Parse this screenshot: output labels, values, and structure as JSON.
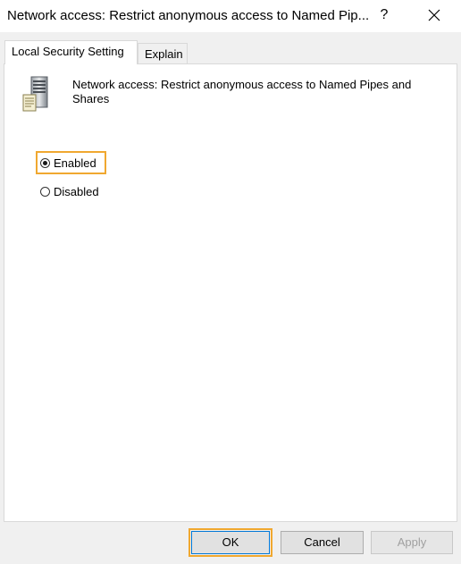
{
  "window": {
    "title": "Network access: Restrict anonymous access to Named Pip...",
    "help_label": "?"
  },
  "tabs": [
    {
      "label": "Local Security Setting",
      "active": true
    },
    {
      "label": "Explain",
      "active": false
    }
  ],
  "policy": {
    "icon": "server-policy-icon",
    "name": "Network access: Restrict anonymous access to Named Pipes and Shares"
  },
  "options": {
    "enabled_label": "Enabled",
    "disabled_label": "Disabled",
    "selected": "Enabled"
  },
  "buttons": {
    "ok": "OK",
    "cancel": "Cancel",
    "apply": "Apply"
  },
  "colors": {
    "highlight": "#f0a830",
    "disabled_text": "#a0a0a0"
  }
}
